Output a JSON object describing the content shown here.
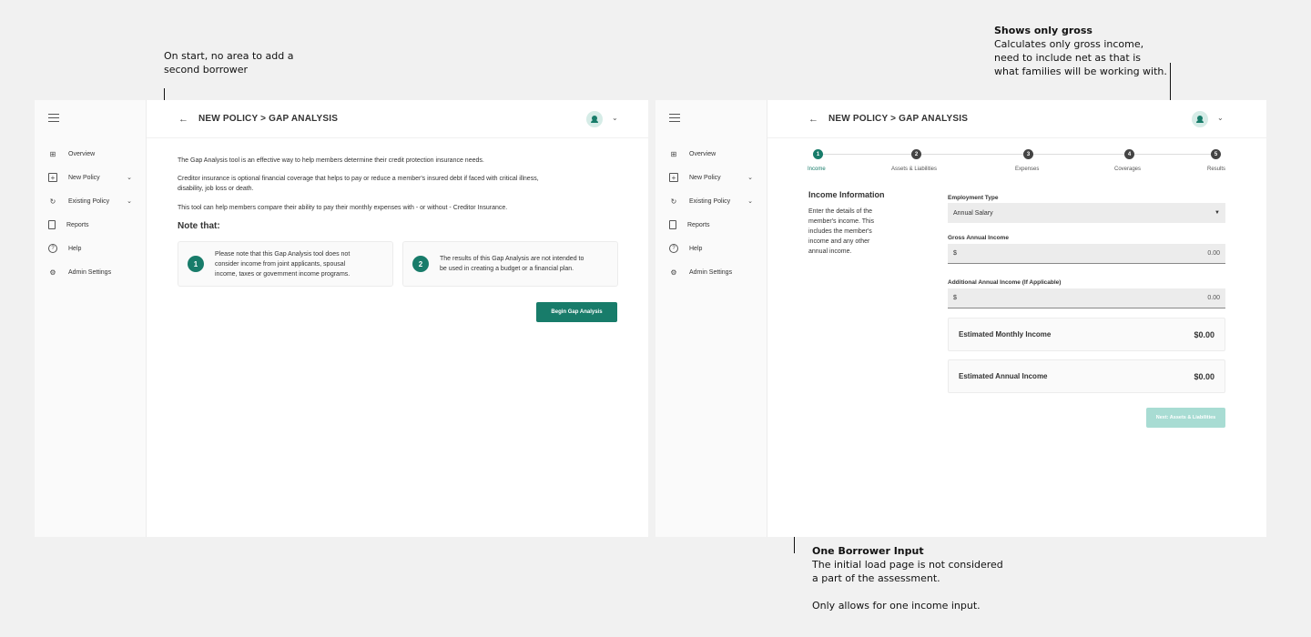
{
  "annotations": {
    "left_note": {
      "line1": "On start, no area to add a",
      "line2": "second borrower"
    },
    "right_note": {
      "title": "Shows only gross",
      "line1": "Calculates only gross income,",
      "line2": "need to include net as that is",
      "line3": "what families will be working with."
    },
    "bottom_note": {
      "title": "One Borrower Input",
      "line1": "The initial load page is not considered",
      "line2": "a part of the assessment.",
      "line3": "Only allows for one income input."
    }
  },
  "sidebar": {
    "items": [
      {
        "label": "Overview",
        "icon": "grid-icon"
      },
      {
        "label": "New Policy",
        "icon": "plus-square-icon",
        "chevron": true
      },
      {
        "label": "Existing Policy",
        "icon": "refresh-icon",
        "chevron": true
      },
      {
        "label": "Reports",
        "icon": "document-icon"
      },
      {
        "label": "Help",
        "icon": "help-icon"
      },
      {
        "label": "Admin Settings",
        "icon": "gear-icon"
      }
    ]
  },
  "intro_screen": {
    "title": "NEW POLICY > GAP ANALYSIS",
    "para1": "The Gap Analysis tool is an effective way to help members determine their credit protection insurance needs.",
    "para2_line1": "Creditor insurance is optional financial coverage that helps to pay or reduce a member's insured debt if faced with critical illness,",
    "para2_line2": "disability, job loss or death.",
    "para3": "This tool can help members compare their ability to pay their monthly expenses with - or without - Creditor Insurance.",
    "note_title": "Note that:",
    "note1": {
      "num": "1",
      "line1": "Please note that this Gap Analysis tool does not",
      "line2": "consider income from joint applicants, spousal",
      "line3": "income, taxes or  government income programs."
    },
    "note2": {
      "num": "2",
      "line1": "The results of this Gap Analysis are not intended to",
      "line2": "be used in creating a budget or a financial plan."
    },
    "begin_button": "Begin Gap Analysis"
  },
  "income_screen": {
    "title": "NEW POLICY > GAP ANALYSIS",
    "steps": [
      {
        "num": "1",
        "label": "Income",
        "active": true
      },
      {
        "num": "2",
        "label": "Assets & Liabilities"
      },
      {
        "num": "3",
        "label": "Expenses"
      },
      {
        "num": "4",
        "label": "Coverages"
      },
      {
        "num": "5",
        "label": "Results"
      }
    ],
    "section_title": "Income Information",
    "section_desc": [
      "Enter the details of the",
      "member's income. This",
      "includes the member's",
      "income and any other",
      "annual income."
    ],
    "employment_type": {
      "label": "Employment Type",
      "value": "Annual Salary"
    },
    "gross_income": {
      "label": "Gross Annual Income",
      "prefix": "$",
      "value": "0.00"
    },
    "additional_income": {
      "label": "Additional Annual Income (If Applicable)",
      "prefix": "$",
      "value": "0.00"
    },
    "monthly": {
      "label": "Estimated Monthly Income",
      "value": "$0.00"
    },
    "annual": {
      "label": "Estimated Annual Income",
      "value": "$0.00"
    },
    "next_button": "Next: Assets & Liabilities"
  },
  "colors": {
    "accent": "#187c6a",
    "accent_disabled": "#a8dcd3"
  }
}
